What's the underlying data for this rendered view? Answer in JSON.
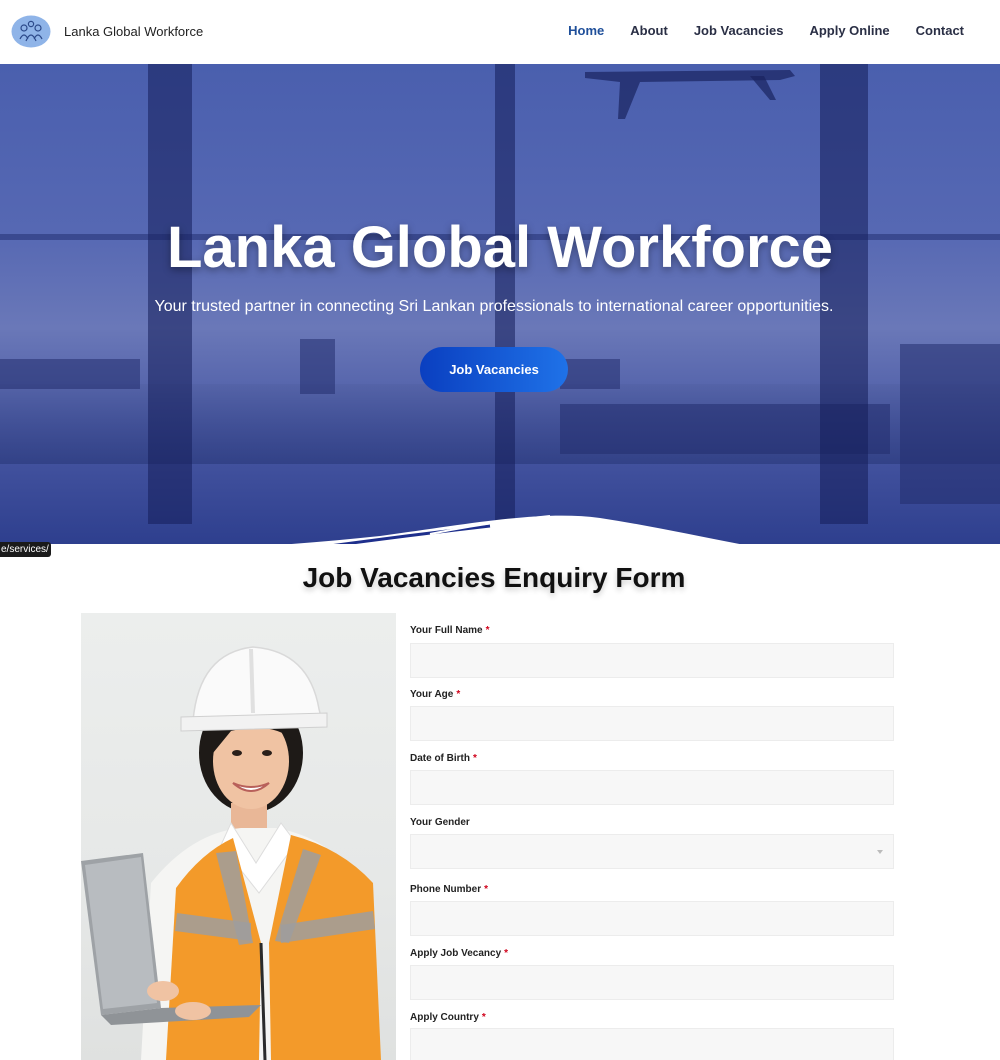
{
  "header": {
    "brand": "Lanka Global Workforce",
    "nav": [
      {
        "label": "Home",
        "active": true
      },
      {
        "label": "About",
        "active": false
      },
      {
        "label": "Job Vacancies",
        "active": false
      },
      {
        "label": "Apply Online",
        "active": false
      },
      {
        "label": "Contact",
        "active": false
      }
    ]
  },
  "hero": {
    "title": "Lanka Global Workforce",
    "subtitle": "Your trusted partner in connecting Sri Lankan professionals to international career opportunities.",
    "button_label": "Job Vacancies"
  },
  "tooltip": "e/services/",
  "form": {
    "title": "Job Vacancies Enquiry Form",
    "fields": [
      {
        "label": "Your Full Name",
        "required": true,
        "type": "text",
        "value": ""
      },
      {
        "label": "Your Age",
        "required": true,
        "type": "text",
        "value": ""
      },
      {
        "label": "Date of Birth",
        "required": true,
        "type": "text",
        "value": ""
      },
      {
        "label": "Your Gender",
        "required": false,
        "type": "select",
        "value": ""
      },
      {
        "label": "Phone Number",
        "required": true,
        "type": "text",
        "value": ""
      },
      {
        "label": "Apply Job Vecancy",
        "required": true,
        "type": "text",
        "value": ""
      },
      {
        "label": "Apply Country",
        "required": true,
        "type": "text",
        "value": ""
      }
    ],
    "required_mark": "*"
  },
  "icons": {
    "logo": "people-circle-logo-icon",
    "select_arrow": "chevron-down-icon"
  },
  "colors": {
    "nav_active": "#1f4f9a",
    "nav_text": "#2a2f45",
    "button_start": "#0a3fc0",
    "button_end": "#1f72e8",
    "required": "#d0021b"
  }
}
